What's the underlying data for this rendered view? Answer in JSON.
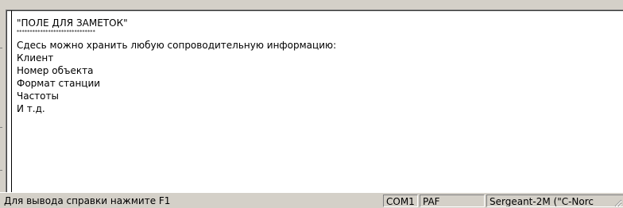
{
  "notes": {
    "heading": "\"ПОЛЕ ДЛЯ ЗАМЕТОК\"",
    "stars": "******************************",
    "lines": [
      "Сдесь можно хранить любую сопроводительную информацию:",
      "Клиент",
      "Номер объекта",
      "Формат станции",
      "Частоты",
      "И т.д."
    ]
  },
  "statusbar": {
    "help_text": "Для вывода справки нажмите F1",
    "port": "COM1",
    "protocol": "PAF",
    "device": "Sergeant-2M (\"C-Norc"
  },
  "colors": {
    "window_bg": "#d4d0c8",
    "text_area_bg": "#ffffff",
    "text": "#000000"
  }
}
